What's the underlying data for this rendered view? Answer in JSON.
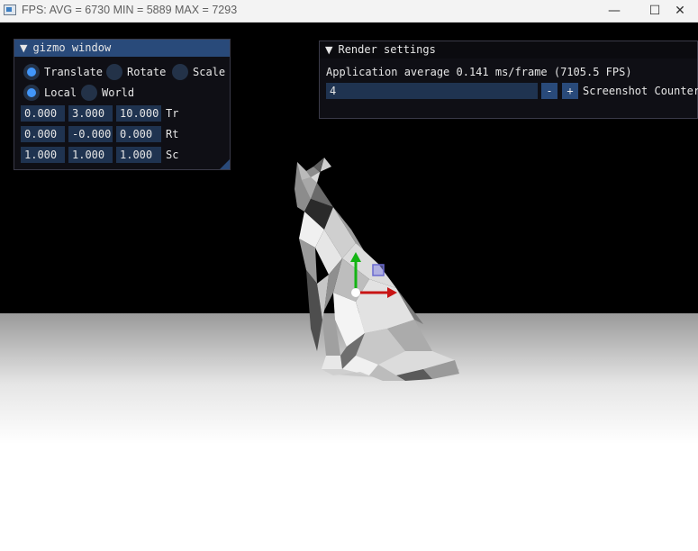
{
  "window": {
    "title": "FPS: AVG = 6730 MIN = 5889 MAX = 7293",
    "minimize_icon": "minimize-icon",
    "maximize_icon": "maximize-icon",
    "close_icon": "close-icon",
    "minimize_glyph": "—",
    "maximize_glyph": "☐",
    "close_glyph": "✕"
  },
  "gizmo_window": {
    "title": "gizmo window",
    "collapse_glyph": "▼",
    "operations": [
      {
        "label": "Translate",
        "selected": true
      },
      {
        "label": "Rotate",
        "selected": false
      },
      {
        "label": "Scale",
        "selected": false
      }
    ],
    "modes": [
      {
        "label": "Local",
        "selected": true
      },
      {
        "label": "World",
        "selected": false
      }
    ],
    "rows": [
      {
        "label": "Tr",
        "values": [
          "0.000",
          "3.000",
          "10.000"
        ]
      },
      {
        "label": "Rt",
        "values": [
          "0.000",
          "-0.000",
          "0.000"
        ]
      },
      {
        "label": "Sc",
        "values": [
          "1.000",
          "1.000",
          "1.000"
        ]
      }
    ]
  },
  "render_settings": {
    "title": "Render settings",
    "collapse_glyph": "▼",
    "stats": "Application average 0.141 ms/frame (7105.5 FPS)",
    "counter_value": "4",
    "minus_label": "-",
    "plus_label": "+",
    "counter_label": "Screenshot Counter"
  },
  "scene": {
    "background_color": "#000000",
    "floor_color": "#ffffff",
    "model": "low-poly cat",
    "gizmo_axes": {
      "x_color": "#c81414",
      "y_color": "#14b414",
      "plane_color": "#8a8ae6"
    }
  }
}
